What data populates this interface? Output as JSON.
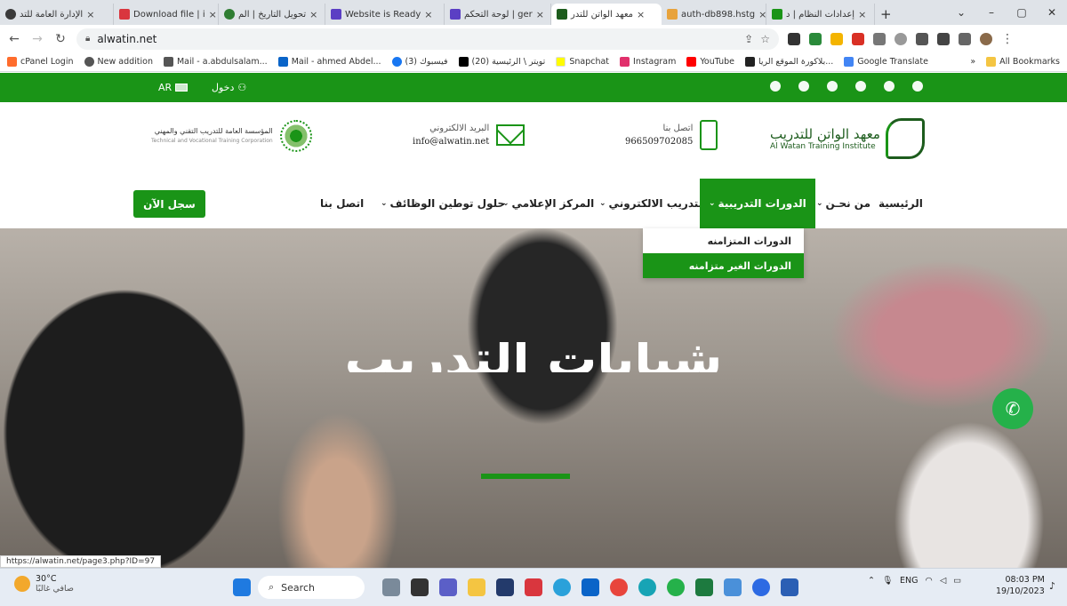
{
  "browser": {
    "tabs": [
      {
        "title": "الإدارة العامة للتد",
        "color": "#3a3a3a"
      },
      {
        "title": "Download file | i",
        "color": "#d9363e"
      },
      {
        "title": "تحويل التاريخ | الم",
        "color": "#2f7d32"
      },
      {
        "title": "Website is Ready",
        "color": "#5b3fc4"
      },
      {
        "title": "لوحة التحكم | ger",
        "color": "#5b3fc4"
      },
      {
        "title": "معهد الواتن للتدر",
        "color": "#1d5c1d",
        "active": true
      },
      {
        "title": "auth-db898.hstg",
        "color": "#e8a33c"
      },
      {
        "title": "إعدادات النظام | د",
        "color": "#1a9417"
      }
    ],
    "url": "alwatin.net",
    "bookmarks": [
      {
        "label": "cPanel Login",
        "color": "#ff6c2c"
      },
      {
        "label": "New addition",
        "color": "#555555"
      },
      {
        "label": "Mail - a.abdulsalam...",
        "color": "#555555"
      },
      {
        "label": "Mail - ahmed Abdel...",
        "color": "#0a64c8"
      },
      {
        "label": "(3) فيسبوك",
        "color": "#1877f2"
      },
      {
        "label": "(20) تويتر \\ الرئيسية",
        "color": "#000000"
      },
      {
        "label": "Snapchat",
        "color": "#fffc00"
      },
      {
        "label": "Instagram",
        "color": "#e1306c"
      },
      {
        "label": "YouTube",
        "color": "#ff0000"
      },
      {
        "label": "بلاكورة الموقع الريا...",
        "color": "#222222"
      },
      {
        "label": "Google Translate",
        "color": "#4285f4"
      }
    ],
    "all_bookmarks": "All Bookmarks"
  },
  "topbar": {
    "lang": "AR",
    "login": "دخول"
  },
  "header": {
    "brand_ar": "معهد الواتن للتدريب",
    "brand_en": "Al Watan Training Institute",
    "phone_label": "اتصل بنا",
    "phone_value": "966509702085",
    "email_label": "البريد الالكتروني",
    "email_value": "info@alwatin.net",
    "partner_ar": "المؤسسة العامة للتدريب التقني والمهني",
    "partner_en": "Technical and Vocational Training Corporation"
  },
  "menu": {
    "home": "الرئيسية",
    "about": "من نحـن",
    "courses": "الدورات التدريبية",
    "elearning": "التدريب الالكتروني",
    "media": "المركز الإعلامي",
    "jobs": "حلول توطين الوظائف",
    "contact": "اتصل بنا",
    "register": "سجل الآن"
  },
  "dropdown": {
    "sync": "الدورات المتزامنه",
    "async": "الدورات الغير متزامنه"
  },
  "hero": {
    "title": "شبابات التدريب"
  },
  "status_url": "https://alwatin.net/page3.php?ID=97",
  "taskbar": {
    "temp": "30°C",
    "weather": "صافي غالبًا",
    "search": "Search",
    "lang": "ENG",
    "time": "08:03 PM",
    "date": "19/10/2023"
  }
}
